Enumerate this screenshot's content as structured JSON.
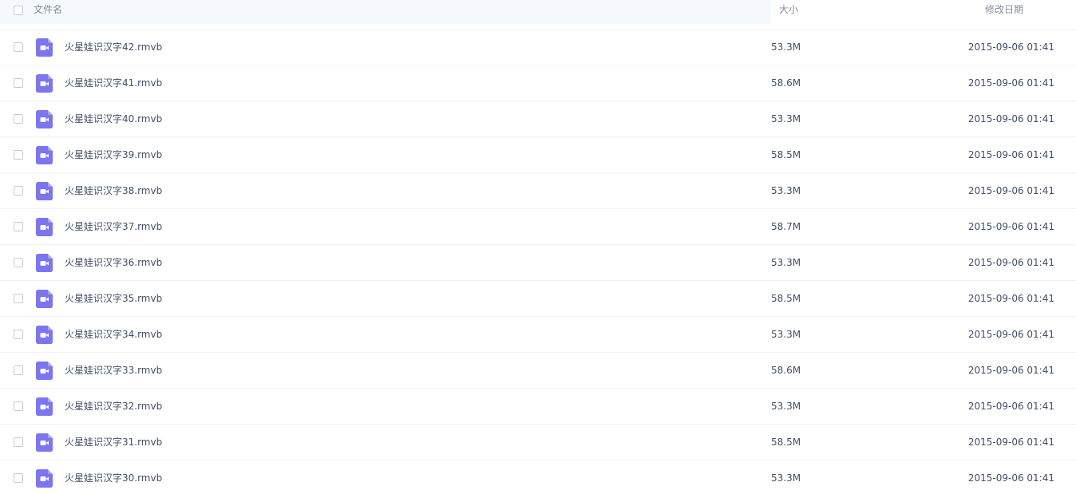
{
  "header": {
    "name_label": "文件名",
    "size_label": "大小",
    "date_label": "修改日期"
  },
  "icon_color": "#7c75f0",
  "files": [
    {
      "name": "火星娃识汉字42.rmvb",
      "size": "53.3M",
      "date": "2015-09-06 01:41",
      "icon": "video-file-icon"
    },
    {
      "name": "火星娃识汉字41.rmvb",
      "size": "58.6M",
      "date": "2015-09-06 01:41",
      "icon": "video-file-icon"
    },
    {
      "name": "火星娃识汉字40.rmvb",
      "size": "53.3M",
      "date": "2015-09-06 01:41",
      "icon": "video-file-icon"
    },
    {
      "name": "火星娃识汉字39.rmvb",
      "size": "58.5M",
      "date": "2015-09-06 01:41",
      "icon": "video-file-icon"
    },
    {
      "name": "火星娃识汉字38.rmvb",
      "size": "53.3M",
      "date": "2015-09-06 01:41",
      "icon": "video-file-icon"
    },
    {
      "name": "火星娃识汉字37.rmvb",
      "size": "58.7M",
      "date": "2015-09-06 01:41",
      "icon": "video-file-icon"
    },
    {
      "name": "火星娃识汉字36.rmvb",
      "size": "53.3M",
      "date": "2015-09-06 01:41",
      "icon": "video-file-icon"
    },
    {
      "name": "火星娃识汉字35.rmvb",
      "size": "58.5M",
      "date": "2015-09-06 01:41",
      "icon": "video-file-icon"
    },
    {
      "name": "火星娃识汉字34.rmvb",
      "size": "53.3M",
      "date": "2015-09-06 01:41",
      "icon": "video-file-icon"
    },
    {
      "name": "火星娃识汉字33.rmvb",
      "size": "58.6M",
      "date": "2015-09-06 01:41",
      "icon": "video-file-icon"
    },
    {
      "name": "火星娃识汉字32.rmvb",
      "size": "53.3M",
      "date": "2015-09-06 01:41",
      "icon": "video-file-icon"
    },
    {
      "name": "火星娃识汉字31.rmvb",
      "size": "58.5M",
      "date": "2015-09-06 01:41",
      "icon": "video-file-icon"
    },
    {
      "name": "火星娃识汉字30.rmvb",
      "size": "53.3M",
      "date": "2015-09-06 01:41",
      "icon": "video-file-icon"
    }
  ]
}
